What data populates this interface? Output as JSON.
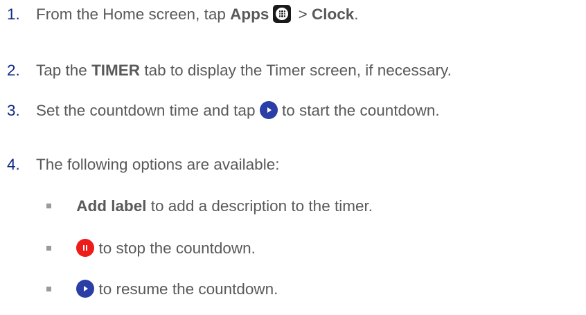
{
  "steps": [
    {
      "number": "1.",
      "text_before": "From the Home screen, tap ",
      "bold1": "Apps",
      "icon": "apps-grid-icon",
      "text_middle": " > ",
      "bold2": "Clock",
      "text_after": "."
    },
    {
      "number": "2.",
      "text_before": "Tap the ",
      "bold": "TIMER",
      "text_after": " tab to display the Timer screen, if necessary."
    },
    {
      "number": "3.",
      "text_before": "Set the countdown time and tap ",
      "icon": "play-icon",
      "text_after": " to start the countdown."
    },
    {
      "number": "4.",
      "text": "The following options are available:"
    }
  ],
  "options": [
    {
      "bold": "Add label",
      "text": " to add a description to the timer."
    },
    {
      "icon": "pause-icon",
      "text": "to stop the countdown."
    },
    {
      "icon": "play-icon",
      "text": "to resume the countdown."
    }
  ],
  "colors": {
    "step_number": "#0e2a86",
    "body_text": "#595959",
    "play_button": "#2b3ea6",
    "pause_button": "#ee1b1b",
    "bullet": "#9a9a9a"
  }
}
